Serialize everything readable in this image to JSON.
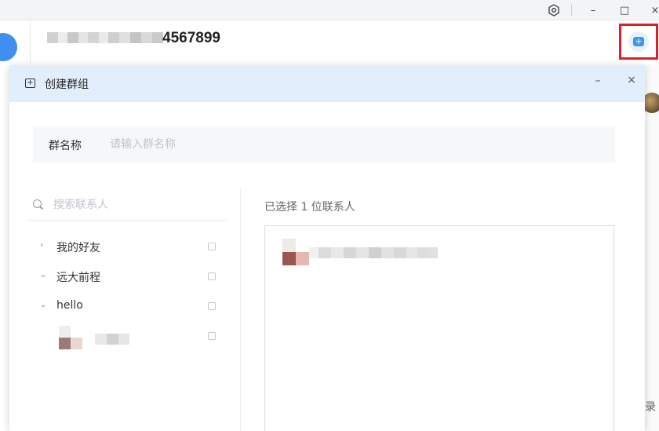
{
  "window": {
    "settings_icon": "settings-icon",
    "minimize_glyph": "–",
    "maximize_glyph": "□",
    "close_glyph": "×"
  },
  "chat_header": {
    "title_visible": "4567899"
  },
  "dialog": {
    "title": "创建群组",
    "minimize_glyph": "–",
    "close_glyph": "×",
    "group_name": {
      "label": "群名称",
      "placeholder": "请输入群名称",
      "value": ""
    },
    "contacts": {
      "search_placeholder": "搜索联系人",
      "groups": [
        {
          "label": "我的好友",
          "chevron": "›",
          "expanded": false
        },
        {
          "label": "远大前程",
          "chevron": "⌄",
          "expanded": true
        },
        {
          "label": "hello",
          "chevron": "⌄",
          "expanded": true
        }
      ]
    },
    "selected": {
      "summary": "已选择 1 位联系人"
    }
  },
  "background": {
    "side_text": "录"
  },
  "colors": {
    "accent": "#3f96ec",
    "highlight_border": "#d8212a",
    "dialog_header_bg": "#e2eefb"
  }
}
